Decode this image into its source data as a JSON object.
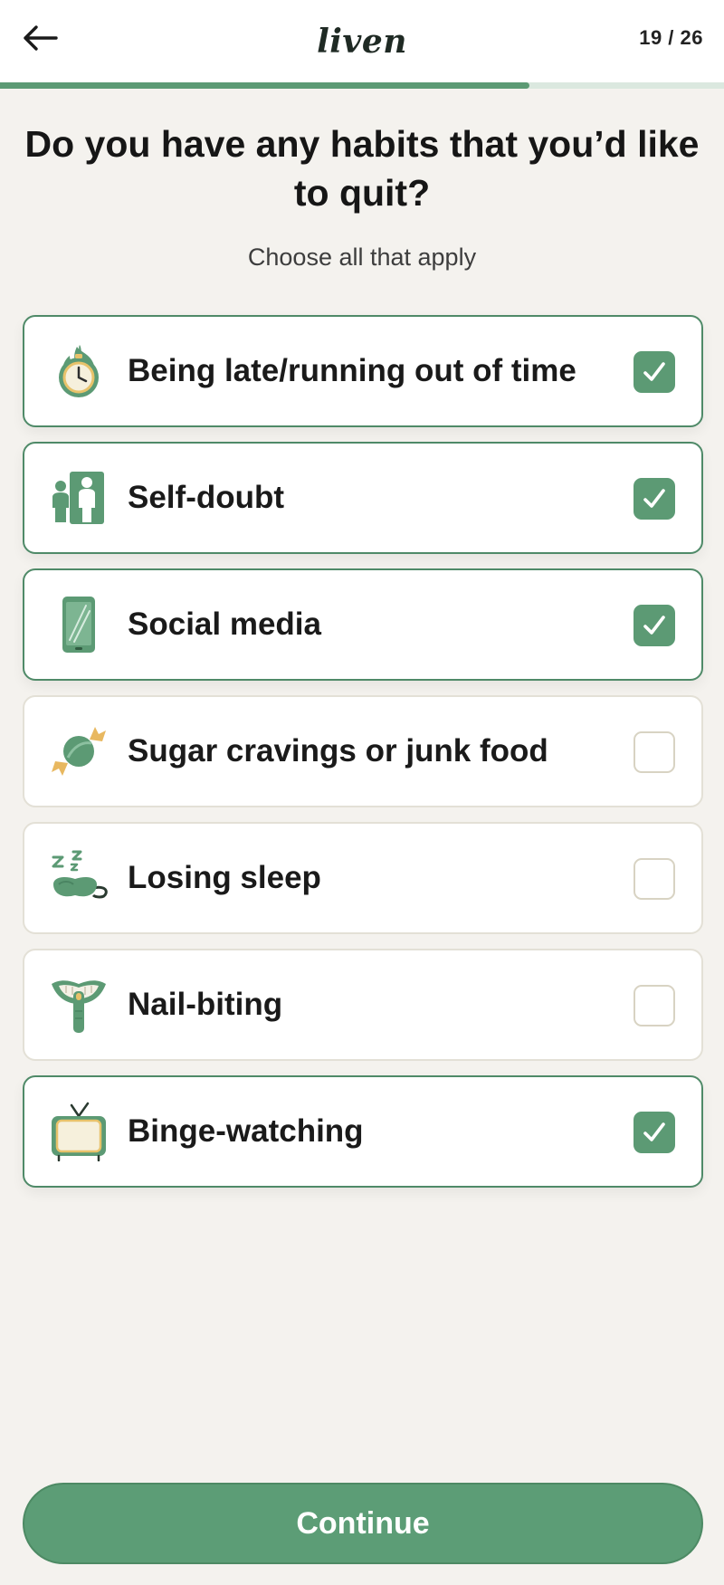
{
  "header": {
    "logo": "liven",
    "step": "19 / 26",
    "progress": 0.731
  },
  "question": {
    "title": "Do you have any habits that you’d like to quit?",
    "subtitle": "Choose all that apply"
  },
  "options": [
    {
      "label": "Being late/running out of time",
      "icon": "clock-fire-icon",
      "checked": true
    },
    {
      "label": "Self-doubt",
      "icon": "people-mirror-icon",
      "checked": true
    },
    {
      "label": "Social media",
      "icon": "smartphone-icon",
      "checked": true
    },
    {
      "label": "Sugar cravings or junk food",
      "icon": "candy-icon",
      "checked": false
    },
    {
      "label": "Losing sleep",
      "icon": "sleep-mask-icon",
      "checked": false
    },
    {
      "label": "Nail-biting",
      "icon": "nail-biting-mouth-icon",
      "checked": false
    },
    {
      "label": "Binge-watching",
      "icon": "tv-icon",
      "checked": true
    }
  ],
  "continue_label": "Continue",
  "colors": {
    "accent": "#5c9a74",
    "background": "#f4f2ee",
    "card": "#ffffff"
  }
}
